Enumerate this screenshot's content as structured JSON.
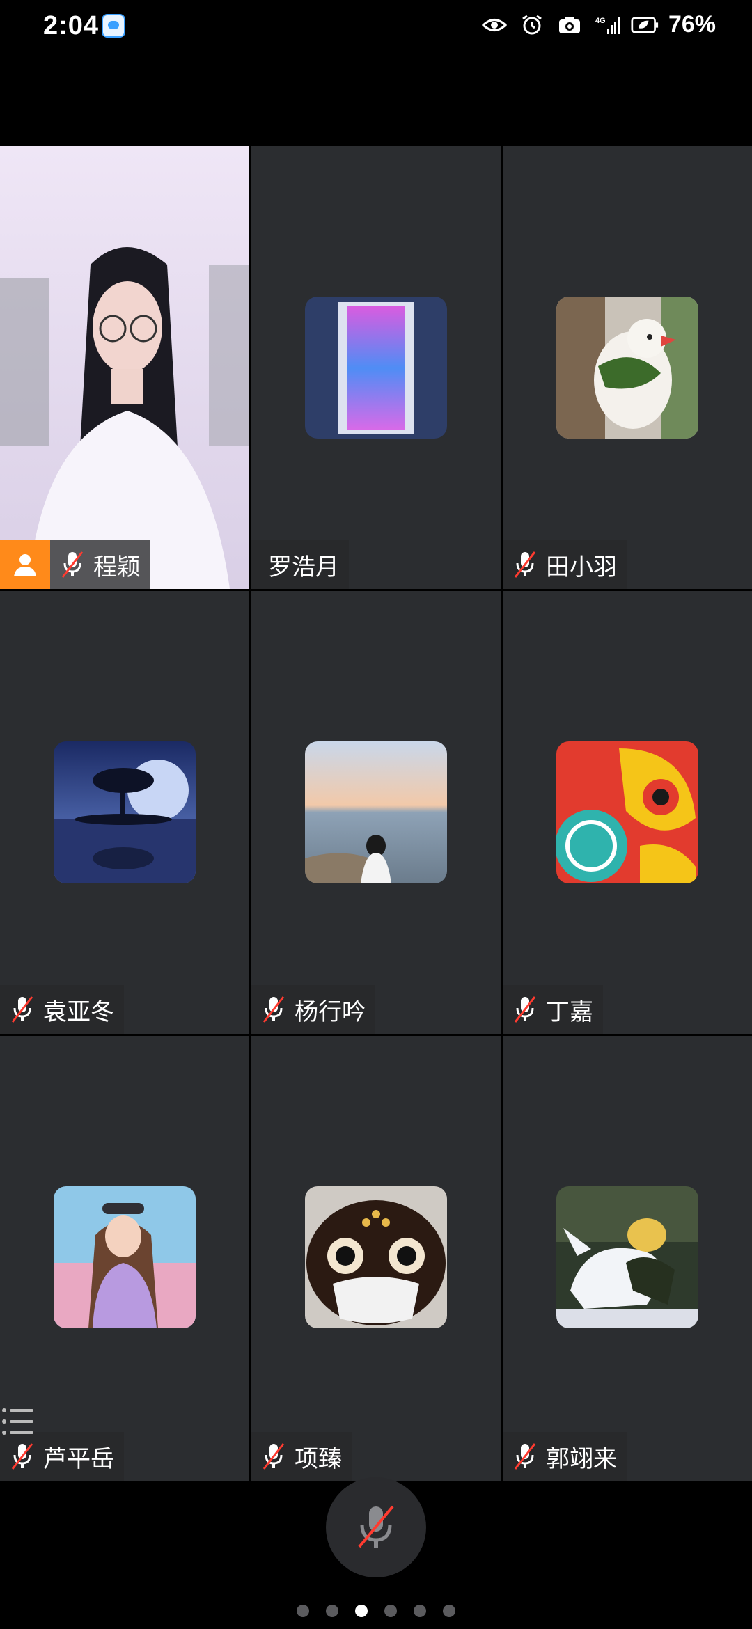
{
  "status_bar": {
    "time": "2:04",
    "network": "4G",
    "battery": "76%",
    "icons": [
      "chat-app-icon",
      "eye-icon",
      "alarm-icon",
      "camera-icon",
      "signal-icon",
      "battery-saver-icon"
    ]
  },
  "participants": [
    {
      "name": "程颖",
      "muted": true,
      "self": true,
      "avatar": "camera-video"
    },
    {
      "name": "罗浩月",
      "muted": false,
      "avatar": "gradient-phone"
    },
    {
      "name": "田小羽",
      "muted": true,
      "avatar": "bird-plush"
    },
    {
      "name": "袁亚冬",
      "muted": true,
      "avatar": "tree-moon"
    },
    {
      "name": "杨行吟",
      "muted": true,
      "avatar": "girl-lake"
    },
    {
      "name": "丁嘉",
      "muted": true,
      "avatar": "lion-art"
    },
    {
      "name": "芦平岳",
      "muted": true,
      "avatar": "girl-illustration"
    },
    {
      "name": "项臻",
      "muted": true,
      "avatar": "fish-mask"
    },
    {
      "name": "郭翊来",
      "muted": true,
      "avatar": "unicorn-rider"
    }
  ],
  "controls": {
    "mic_button": "mic-muted-icon",
    "participant_list": "list-icon"
  },
  "pager": {
    "pages": 6,
    "active": 2
  },
  "colors": {
    "tile_bg": "#2b2d30",
    "self_badge": "#ff8a1a",
    "muted_slash": "#ff3b30"
  }
}
